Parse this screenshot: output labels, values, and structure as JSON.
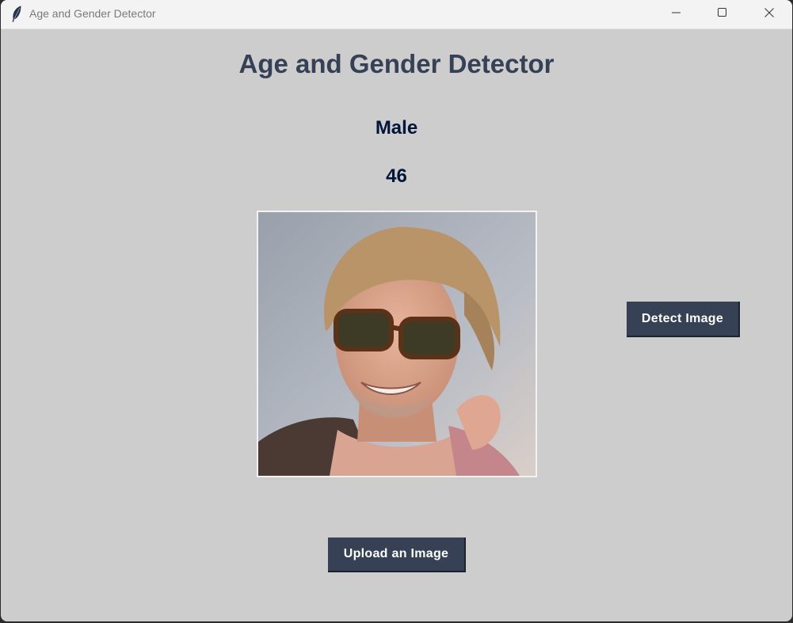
{
  "window": {
    "title": "Age and Gender Detector",
    "icon": "feather-icon",
    "controls": [
      "minimize-icon",
      "maximize-icon",
      "close-icon"
    ]
  },
  "main": {
    "app_title": "Age and Gender Detector",
    "gender_result": "Male",
    "age_result": "46",
    "photo": "uploaded-face-photo"
  },
  "buttons": {
    "detect_label": "Detect Image",
    "upload_label": "Upload an Image"
  },
  "colors": {
    "background": "#cdcdcd",
    "heading": "#364156",
    "result_text": "#011638",
    "button_bg": "#364156",
    "button_text": "#ffffff"
  }
}
